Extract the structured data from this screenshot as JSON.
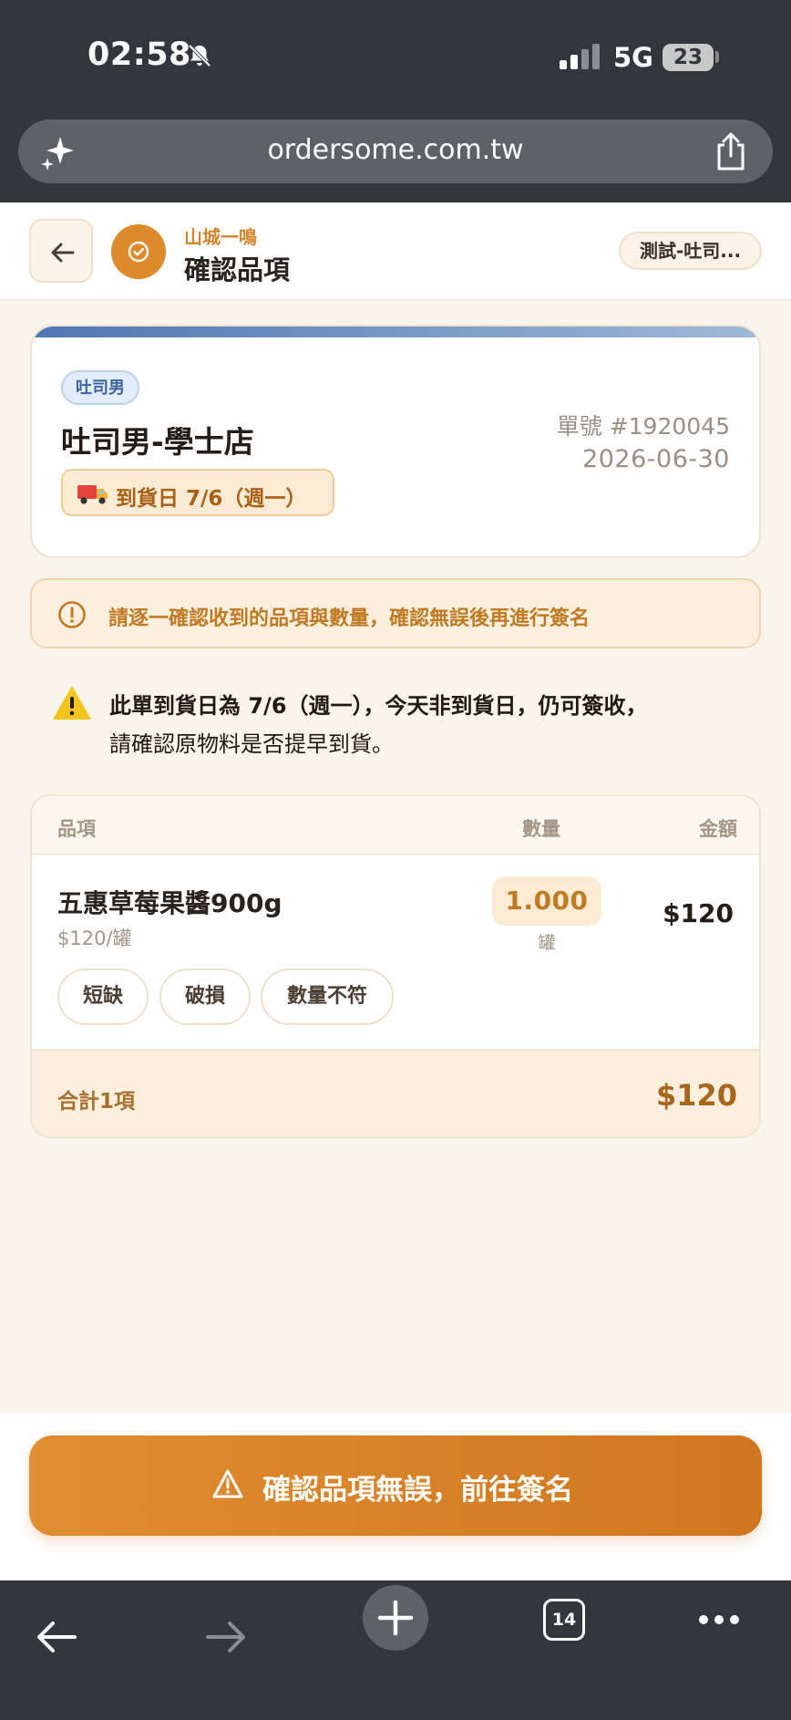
{
  "status_bar": {
    "time": "02:58",
    "network": "5G",
    "battery": "23"
  },
  "browser": {
    "url": "ordersome.com.tw",
    "tab_count": "14"
  },
  "header": {
    "brand": "山城一鳴",
    "title": "確認品項",
    "store_chip": "測試-吐司..."
  },
  "order": {
    "brand_tag": "吐司男",
    "store_name": "吐司男-學士店",
    "delivery": "到貨日 7/6（週一）",
    "order_no": "單號 #1920045",
    "date": "2026-06-30"
  },
  "notice": "請逐一確認收到的品項與數量，確認無誤後再進行簽名",
  "warning": {
    "line1": "此單到貨日為 7/6（週一），今天非到貨日，仍可簽收，",
    "line2": "請確認原物料是否提早到貨。"
  },
  "items_table": {
    "headers": {
      "item": "品項",
      "qty": "數量",
      "amount": "金額"
    },
    "rows": [
      {
        "name": "五惠草莓果醬900g",
        "unit_price": "$120/罐",
        "qty": "1.000",
        "unit": "罐",
        "amount": "$120",
        "issues": [
          "短缺",
          "破損",
          "數量不符"
        ]
      }
    ],
    "footer": {
      "count_label": "合計1項",
      "total": "$120"
    }
  },
  "confirm_button": "確認品項無誤，前往簽名",
  "colors": {
    "accent": "#dd8a2c",
    "brand_blue": "#4f77b1",
    "chrome": "#33363b"
  }
}
